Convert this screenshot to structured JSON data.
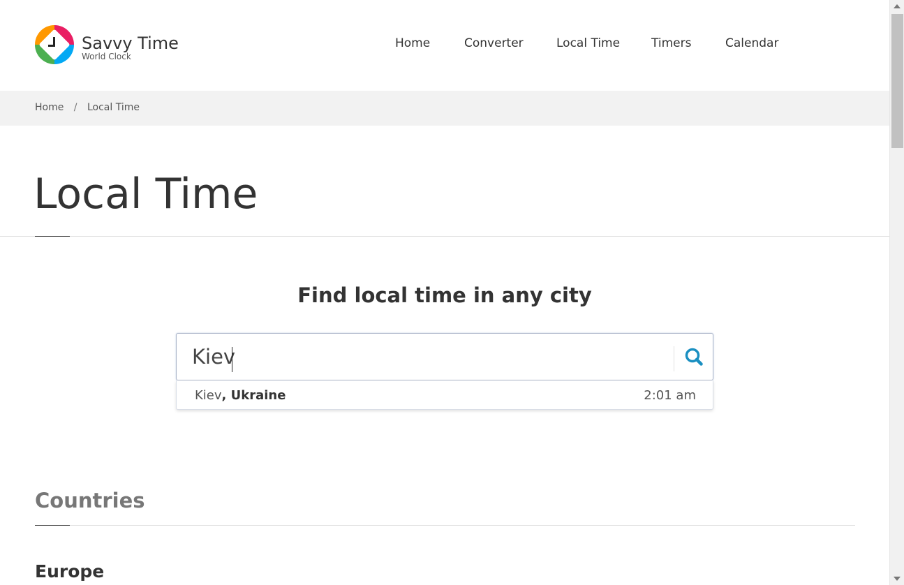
{
  "brand": {
    "name": "Savvy Time",
    "tagline": "World Clock"
  },
  "nav": [
    {
      "label": "Home"
    },
    {
      "label": "Converter"
    },
    {
      "label": "Local Time"
    },
    {
      "label": "Timers"
    },
    {
      "label": "Calendar"
    }
  ],
  "breadcrumb": {
    "home": "Home",
    "separator": "/",
    "current": "Local Time"
  },
  "page": {
    "title": "Local Time"
  },
  "search": {
    "heading": "Find local time in any city",
    "value": "Kiev",
    "icon": "search-icon",
    "suggestions": [
      {
        "city": "Kiev",
        "separator": ", ",
        "country": "Ukraine",
        "time": "2:01 am"
      }
    ]
  },
  "countries": {
    "title": "Countries",
    "first_region": "Europe"
  },
  "colors": {
    "accent": "#1a8fc1",
    "breadcrumb_bg": "#f2f2f2"
  }
}
